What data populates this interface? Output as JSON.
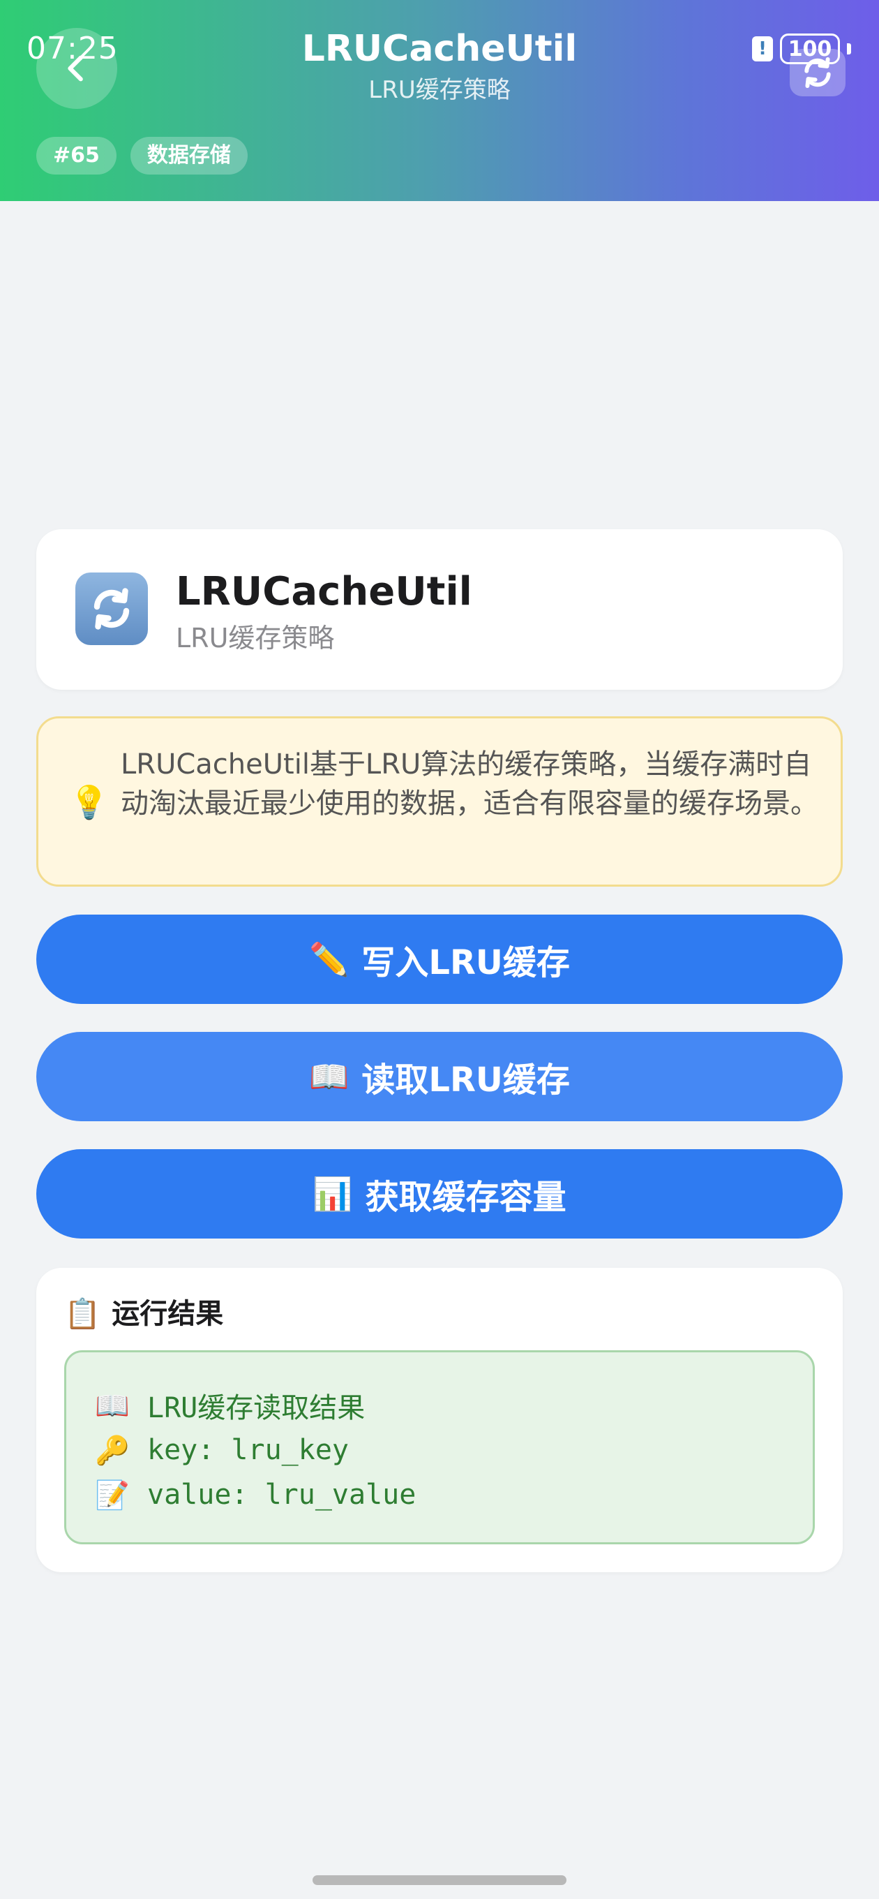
{
  "status_bar": {
    "time": "07:25",
    "battery": "100"
  },
  "header": {
    "title": "LRUCacheUtil",
    "subtitle": "LRU缓存策略",
    "tags": [
      "#65",
      "数据存储"
    ]
  },
  "info_card": {
    "title": "LRUCacheUtil",
    "subtitle": "LRU缓存策略"
  },
  "tip": {
    "icon": "💡",
    "text": "LRUCacheUtil基于LRU算法的缓存策略，当缓存满时自动淘汰最近最少使用的数据，适合有限容量的缓存场景。"
  },
  "buttons": [
    {
      "emoji": "✏️",
      "label": "写入LRU缓存"
    },
    {
      "emoji": "📖",
      "label": "读取LRU缓存"
    },
    {
      "emoji": "📊",
      "label": "获取缓存容量"
    }
  ],
  "result": {
    "emoji": "📋",
    "title": "运行结果",
    "lines": [
      {
        "emoji": "📖",
        "text": "LRU缓存读取结果"
      },
      {
        "emoji": "🔑",
        "text": "key: lru_key"
      },
      {
        "emoji": "📝",
        "text": "value: lru_value"
      }
    ]
  },
  "colors": {
    "primary_button": "#2f7bf1",
    "result_text": "#2e7d32",
    "tip_background": "#fff7e0"
  }
}
